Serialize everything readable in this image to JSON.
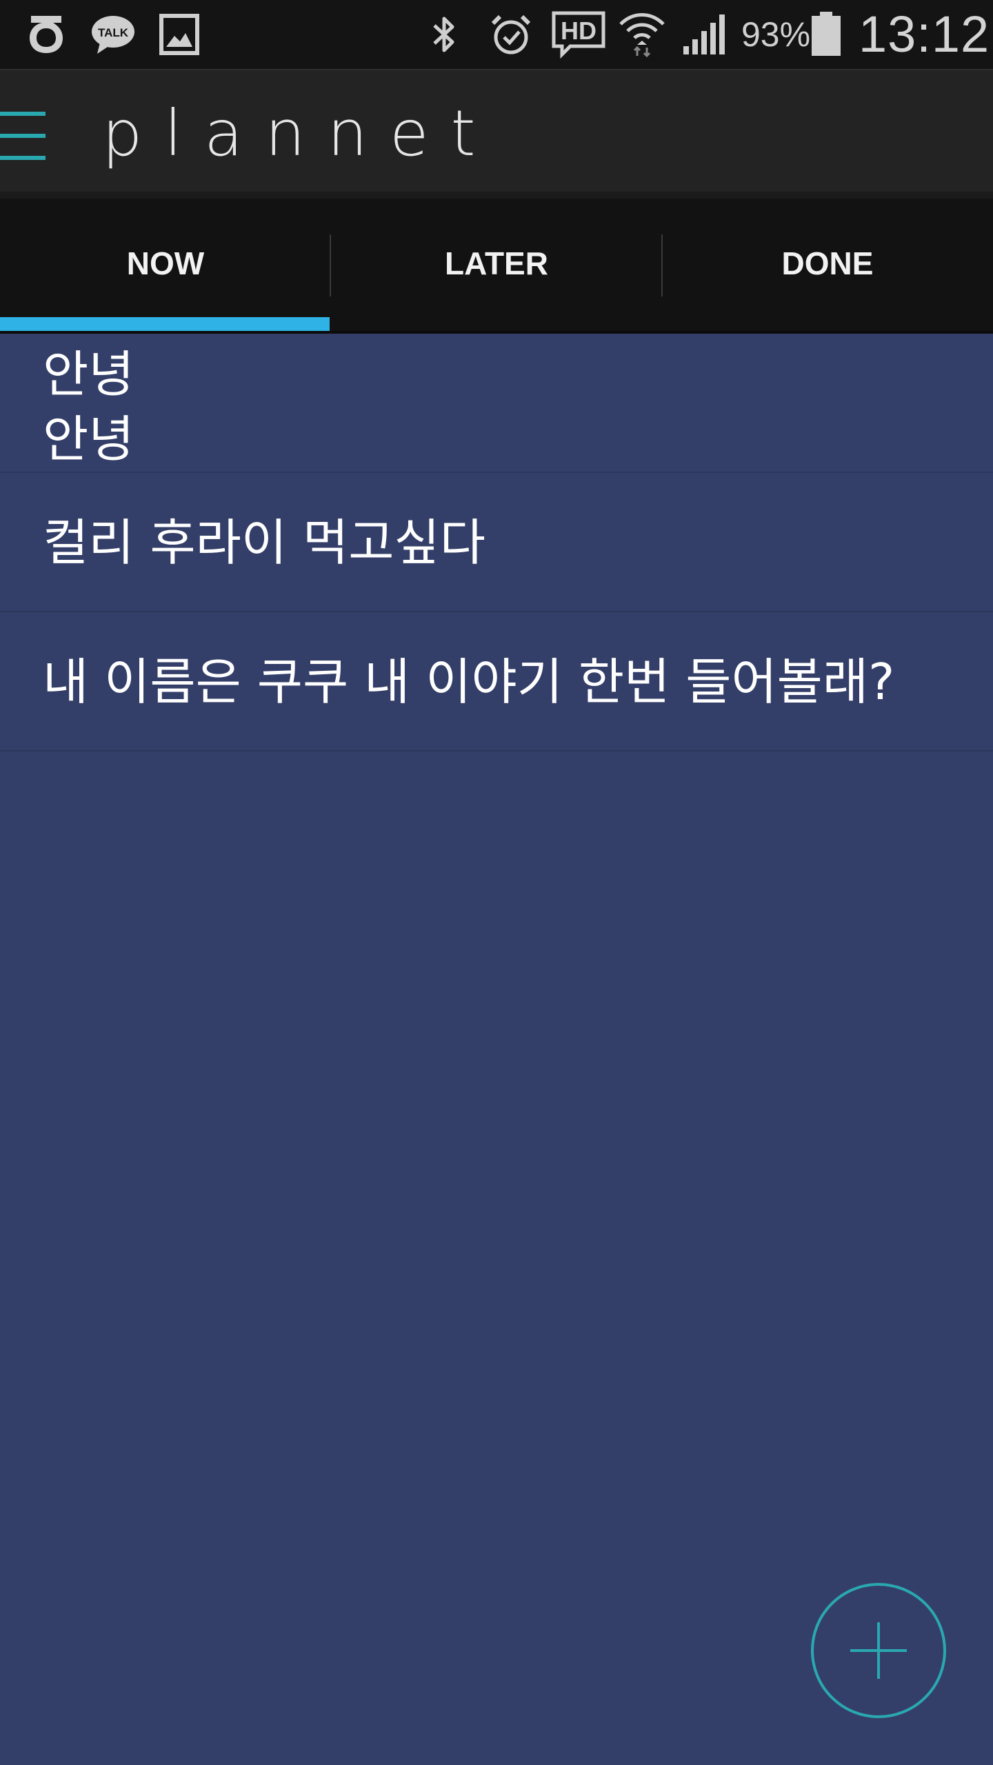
{
  "status_bar": {
    "battery_percent": "93%",
    "time": "13:12",
    "left_icons": [
      "carrier-g-icon",
      "talk-bubble-icon",
      "gallery-icon"
    ],
    "right_icons": [
      "bluetooth-icon",
      "alarm-icon",
      "hd-voice-icon",
      "wifi-icon",
      "signal-icon",
      "battery-icon"
    ],
    "icon_color": "#cfcfcf"
  },
  "app_bar": {
    "title": "plannet",
    "menu_icon": "hamburger-menu-icon",
    "accent_color": "#2aa8b0"
  },
  "tabs": [
    {
      "label": "NOW",
      "selected": true
    },
    {
      "label": "LATER",
      "selected": false
    },
    {
      "label": "DONE",
      "selected": false
    }
  ],
  "tab_indicator_color": "#2fb3e6",
  "tasks": [
    {
      "text": "안녕\n안녕"
    },
    {
      "text": "컬리 후라이 먹고싶다"
    },
    {
      "text": "내 이름은 쿠쿠 내 이야기 한번 들어볼래?"
    }
  ],
  "fab": {
    "icon": "plus-icon",
    "color": "#2aa8b0"
  },
  "background_color": "#343f69"
}
